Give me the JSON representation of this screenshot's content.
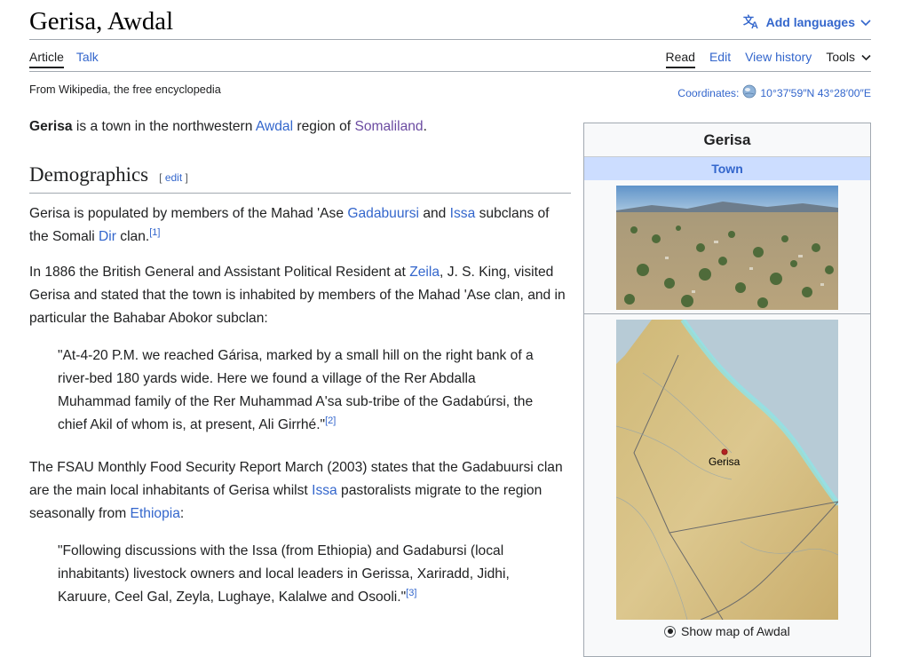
{
  "page": {
    "title": "Gerisa, Awdal",
    "add_languages": "Add languages",
    "tagline": "From Wikipedia, the free encyclopedia"
  },
  "tabs": {
    "article": "Article",
    "talk": "Talk",
    "read": "Read",
    "edit": "Edit",
    "view_history": "View history",
    "tools": "Tools"
  },
  "coordinates": {
    "label": "Coordinates:",
    "value": "10°37′59″N 43°28′00″E"
  },
  "intro": {
    "bold": "Gerisa",
    "t1": " is a town in the northwestern ",
    "link1": "Awdal",
    "t2": " region of ",
    "link2": "Somaliland",
    "t3": "."
  },
  "demographics": {
    "heading": "Demographics",
    "edit_link": "edit",
    "p1": {
      "t1": "Gerisa is populated by members of the Mahad 'Ase ",
      "link1": "Gadabuursi",
      "t2": " and ",
      "link2": "Issa",
      "t3": " subclans of the Somali ",
      "link3": "Dir",
      "t4": " clan.",
      "ref": "[1]"
    },
    "p2": {
      "t1": "In 1886 the British General and Assistant Political Resident at ",
      "link1": "Zeila",
      "t2": ", J. S. King, visited Gerisa and stated that the town is inhabited by members of the Mahad 'Ase clan, and in particular the Bahabar Abokor subclan:"
    },
    "quote1": {
      "text": "\"At-4-20 P.M. we reached Gárisa, marked by a small hill on the right bank of a river-bed 180 yards wide. Here we found a village of the Rer Abdalla Muhammad family of the Rer Muhammad A'sa sub-tribe of the Gadabúrsi, the chief Akil of whom is, at present, Ali Girrhé.\"",
      "ref": "[2]"
    },
    "p3": {
      "t1": "The FSAU Monthly Food Security Report March (2003) states that the Gadabuursi clan are the main local inhabitants of Gerisa whilst ",
      "link1": "Issa",
      "t2": " pastoralists migrate to the region seasonally from ",
      "link2": "Ethiopia",
      "t3": ":"
    },
    "quote2": {
      "text": "\"Following discussions with the Issa (from Ethiopia) and Gadabursi (local inhabitants) livestock owners and local leaders in Gerissa, Xariradd, Jidhi, Karuure, Ceel Gal, Zeyla, Lughaye, Kalalwe and Osooli.\"",
      "ref": "[3]"
    }
  },
  "infobox": {
    "title": "Gerisa",
    "subtitle": "Town",
    "map_marker_label": "Gerisa",
    "show_map_option": "Show map of Awdal"
  },
  "colors": {
    "link": "#3366cc",
    "visited_link": "#6b4ba1",
    "infobox_header": "#ccddff",
    "border": "#a2a9b1"
  }
}
